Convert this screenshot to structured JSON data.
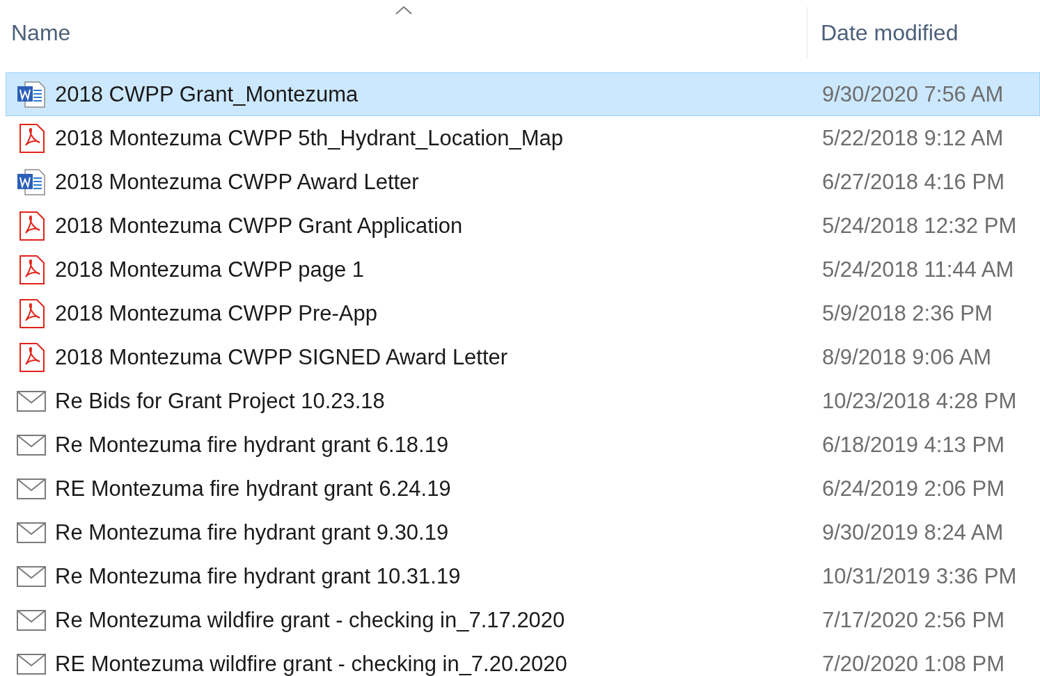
{
  "columns": [
    {
      "label": "Name",
      "sorted": true
    },
    {
      "label": "Date modified",
      "sorted": false
    }
  ],
  "rows": [
    {
      "kind": "word",
      "name": "2018 CWPP Grant_Montezuma",
      "date": "9/30/2020 7:56 AM",
      "selected": true
    },
    {
      "kind": "pdf",
      "name": "2018 Montezuma CWPP 5th_Hydrant_Location_Map",
      "date": "5/22/2018 9:12 AM",
      "selected": false
    },
    {
      "kind": "word",
      "name": "2018 Montezuma CWPP Award Letter",
      "date": "6/27/2018 4:16 PM",
      "selected": false
    },
    {
      "kind": "pdf",
      "name": "2018 Montezuma CWPP Grant Application",
      "date": "5/24/2018 12:32 PM",
      "selected": false
    },
    {
      "kind": "pdf",
      "name": "2018 Montezuma CWPP page 1",
      "date": "5/24/2018 11:44 AM",
      "selected": false
    },
    {
      "kind": "pdf",
      "name": "2018 Montezuma CWPP Pre-App",
      "date": "5/9/2018 2:36 PM",
      "selected": false
    },
    {
      "kind": "pdf",
      "name": "2018 Montezuma CWPP SIGNED Award Letter",
      "date": "8/9/2018 9:06 AM",
      "selected": false
    },
    {
      "kind": "mail",
      "name": "Re Bids for Grant Project 10.23.18",
      "date": "10/23/2018 4:28 PM",
      "selected": false
    },
    {
      "kind": "mail",
      "name": "Re Montezuma fire hydrant grant 6.18.19",
      "date": "6/18/2019 4:13 PM",
      "selected": false
    },
    {
      "kind": "mail",
      "name": "RE Montezuma fire hydrant grant 6.24.19",
      "date": "6/24/2019 2:06 PM",
      "selected": false
    },
    {
      "kind": "mail",
      "name": "Re Montezuma fire hydrant grant 9.30.19",
      "date": "9/30/2019 8:24 AM",
      "selected": false
    },
    {
      "kind": "mail",
      "name": "Re Montezuma fire hydrant grant 10.31.19",
      "date": "10/31/2019 3:36 PM",
      "selected": false
    },
    {
      "kind": "mail",
      "name": "Re Montezuma wildfire grant - checking in_7.17.2020",
      "date": "7/17/2020 2:56 PM",
      "selected": false
    },
    {
      "kind": "mail",
      "name": "RE Montezuma wildfire grant - checking in_7.20.2020",
      "date": "7/20/2020 1:08 PM",
      "selected": false
    }
  ]
}
